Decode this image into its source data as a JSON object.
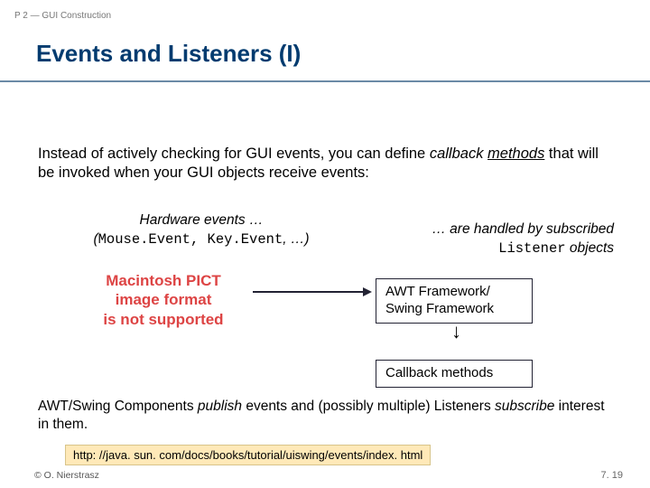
{
  "header": "P 2 — GUI Construction",
  "title": "Events and Listeners (I)",
  "intro": {
    "before": "Instead of actively checking for GUI events, you can define ",
    "callback": "callback",
    "methods": "methods",
    "after": " that will be invoked when your GUI objects receive events:"
  },
  "left": {
    "line1": "Hardware events …",
    "line2_open": "(",
    "line2_code": "Mouse.Event, Key.Event",
    "line2_close": ", …)"
  },
  "right": {
    "prefix": "… are handled by subscribed",
    "code": "Listener",
    "suffix": " objects"
  },
  "pict": {
    "l1": "Macintosh PICT",
    "l2": "image format",
    "l3": "is not supported"
  },
  "box1": {
    "l1": "AWT Framework/",
    "l2": "Swing Framework"
  },
  "box2": {
    "l1": "Callback methods"
  },
  "arrow_down": "↓",
  "summary": {
    "before": "AWT/Swing Components ",
    "publish": "publish",
    "mid": " events and (possibly multiple) Listeners ",
    "subscribe": "subscribe",
    "after": " interest in them."
  },
  "url": "http: //java. sun. com/docs/books/tutorial/uiswing/events/index. html",
  "footer_left": "© O. Nierstrasz",
  "footer_right": "7. 19"
}
